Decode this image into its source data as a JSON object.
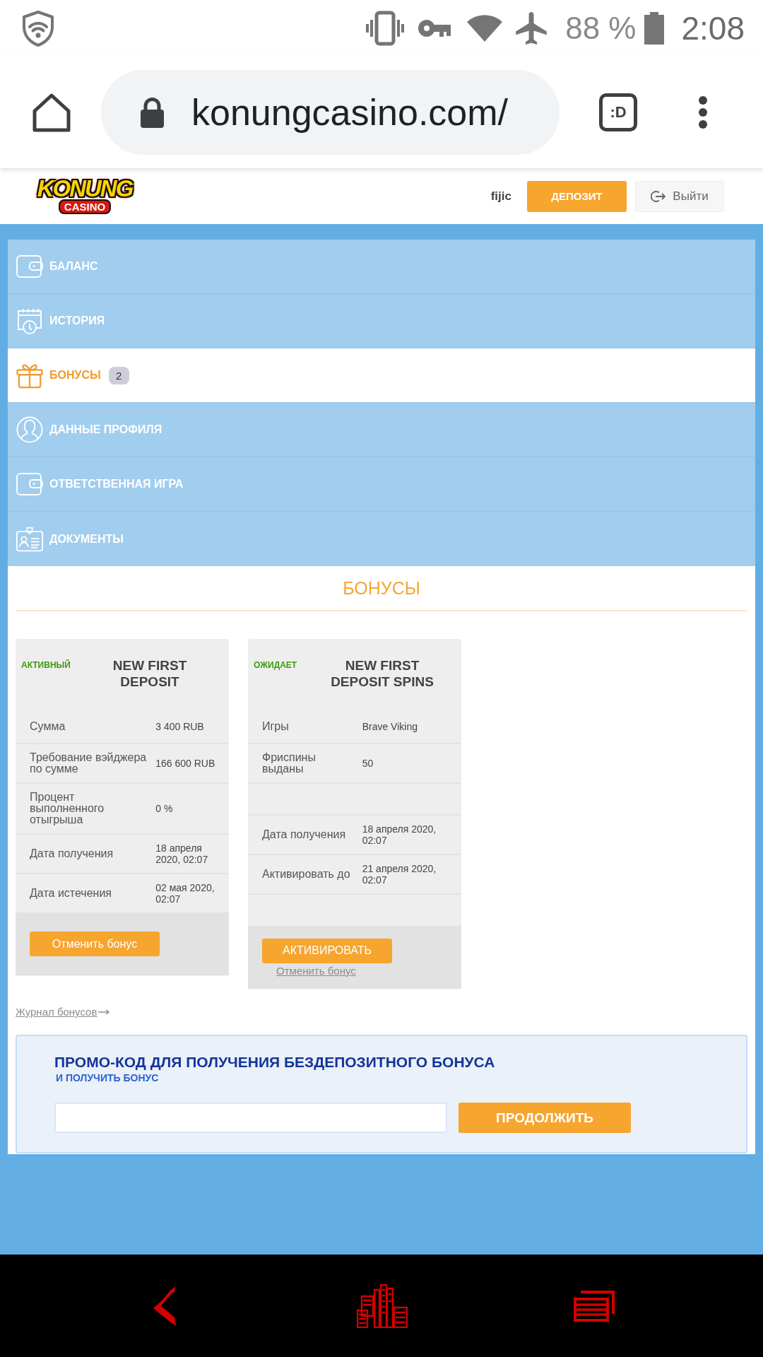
{
  "status_bar": {
    "battery": "88 %",
    "time": "2:08"
  },
  "browser": {
    "url": "konungcasino.com/",
    "extension_button": ":D"
  },
  "site_header": {
    "logo": {
      "wordmark": "KONUNG",
      "subtitle": "CASINO"
    },
    "username": "fijic",
    "deposit_button": "ДЕПОЗИТ",
    "logout_button": "Выйти"
  },
  "menu": [
    {
      "label": "БАЛАНС",
      "selected": false
    },
    {
      "label": "ИСТОРИЯ",
      "selected": false
    },
    {
      "label": "БОНУСЫ",
      "selected": true,
      "badge": "2"
    },
    {
      "label": "ДАННЫЕ ПРОФИЛЯ",
      "selected": false
    },
    {
      "label": "ОТВЕТСТВЕННАЯ ИГРА",
      "selected": false
    },
    {
      "label": "ДОКУМЕНТЫ",
      "selected": false
    }
  ],
  "content": {
    "title": "БОНУСЫ",
    "bonus_cards": [
      {
        "status": "АКТИВНЫЙ",
        "title": "NEW FIRST DEPOSIT",
        "rows": [
          {
            "kind": "field",
            "label": "Сумма",
            "value": "3 400 RUB"
          },
          {
            "kind": "field",
            "label": "Требование вэйджера по сумме",
            "value": "166 600 RUB"
          },
          {
            "kind": "field",
            "label": "Процент выполненного отыгрыша",
            "value": "0 %"
          },
          {
            "kind": "field",
            "label": "Дата получения",
            "value": "18 апреля 2020, 02:07"
          },
          {
            "kind": "field",
            "label": "Дата истечения",
            "value": "02 мая 2020, 02:07"
          }
        ],
        "actions": [
          {
            "kind": "button",
            "label": "Отменить бонус"
          }
        ]
      },
      {
        "status": "ОЖИДАЕТ",
        "title": "NEW FIRST DEPOSIT SPINS",
        "rows": [
          {
            "kind": "field",
            "label": "Игры",
            "value": "Brave Viking"
          },
          {
            "kind": "field",
            "label": "Фриспины выданы",
            "value": "50"
          },
          {
            "kind": "blank"
          },
          {
            "kind": "field",
            "label": "Дата получения",
            "value": "18 апреля 2020, 02:07"
          },
          {
            "kind": "field",
            "label": "Активировать до",
            "value": "21 апреля 2020, 02:07"
          },
          {
            "kind": "blank"
          }
        ],
        "actions": [
          {
            "kind": "button",
            "label": "АКТИВИРОВАТЬ"
          },
          {
            "kind": "link",
            "label": "Отменить бонус"
          }
        ]
      }
    ],
    "bonus_log_link": "Журнал бонусов",
    "promo": {
      "title": "ПРОМО-КОД ДЛЯ ПОЛУЧЕНИЯ БЕЗДЕПОЗИТНОГО БОНУСА",
      "subtitle": "И ПОЛУЧИТЬ БОНУС",
      "submit_button": "ПРОДОЛЖИТЬ"
    }
  }
}
